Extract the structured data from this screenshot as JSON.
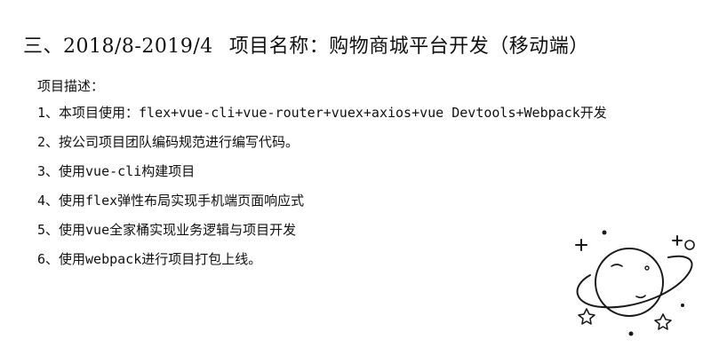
{
  "heading": {
    "period": "三、2018/8-2019/4",
    "project": "项目名称：购物商城平台开发（移动端）"
  },
  "description_label": "项目描述：",
  "items": [
    "1、本项目使用：flex+vue-cli+vue-router+vuex+axios+vue Devtools+Webpack开发",
    "2、按公司项目团队编码规范进行编写代码。",
    "3、使用vue-cli构建项目",
    "4、使用flex弹性布局实现手机端页面响应式",
    "5、使用vue全家桶实现业务逻辑与项目开发",
    "6、使用webpack进行项目打包上线。"
  ],
  "decoration": {
    "icon": "planet-icon"
  }
}
